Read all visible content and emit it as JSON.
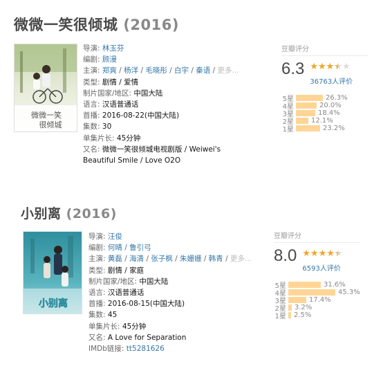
{
  "shows": [
    {
      "title": "微微一笑很倾城",
      "year": "(2016)",
      "director_label": "导演:",
      "director": "林玉芬",
      "writer_label": "编剧:",
      "writer": "顾漫",
      "cast_label": "主演:",
      "cast": [
        "郑爽",
        "杨洋",
        "毛晓彤",
        "白宇",
        "秦语"
      ],
      "cast_more": "更多...",
      "genre_label": "类型:",
      "genre": "剧情 / 爱情",
      "country_label": "制片国家/地区:",
      "country": "中国大陆",
      "language_label": "语言:",
      "language": "汉语普通话",
      "premiere_label": "首播:",
      "premiere": "2016-08-22(中国大陆)",
      "episodes_label": "集数:",
      "episodes": "30",
      "length_label": "单集片长:",
      "length": "45分钟",
      "aka_label": "又名:",
      "aka": "微微一笑很倾城电视剧版 / Weiwei's Beautiful Smile / Love O2O",
      "rating_label": "豆瓣评分",
      "score": "6.3",
      "star_fraction": 0.63,
      "votes": "36763人评价",
      "breakdown": [
        {
          "label": "5星",
          "pct_text": "26.3%",
          "pct": 26.3
        },
        {
          "label": "4星",
          "pct_text": "20.0%",
          "pct": 20.0
        },
        {
          "label": "3星",
          "pct_text": "18.4%",
          "pct": 18.4
        },
        {
          "label": "2星",
          "pct_text": "12.1%",
          "pct": 12.1
        },
        {
          "label": "1星",
          "pct_text": "23.2%",
          "pct": 23.2
        }
      ]
    },
    {
      "title": "小别离",
      "year": "(2016)",
      "director_label": "导演:",
      "director": "汪俊",
      "writer_label": "编剧:",
      "writer": "何晴 / 鲁引弓",
      "cast_label": "主演:",
      "cast": [
        "黄磊",
        "海清",
        "张子枫",
        "朱姗姗",
        "韩青"
      ],
      "cast_more": "更多...",
      "genre_label": "类型:",
      "genre": "剧情 / 家庭",
      "country_label": "制片国家/地区:",
      "country": "中国大陆",
      "language_label": "语言:",
      "language": "汉语普通话",
      "premiere_label": "首播:",
      "premiere": "2016-08-15(中国大陆)",
      "episodes_label": "集数:",
      "episodes": "45",
      "length_label": "单集片长:",
      "length": "45分钟",
      "aka_label": "又名:",
      "aka": "A Love for Separation",
      "imdb_label": "IMDb链接:",
      "imdb": "tt5281626",
      "rating_label": "豆瓣评分",
      "score": "8.0",
      "star_fraction": 0.8,
      "votes": "6593人评价",
      "breakdown": [
        {
          "label": "5星",
          "pct_text": "31.6%",
          "pct": 31.6
        },
        {
          "label": "4星",
          "pct_text": "45.3%",
          "pct": 45.3
        },
        {
          "label": "3星",
          "pct_text": "17.4%",
          "pct": 17.4
        },
        {
          "label": "2星",
          "pct_text": "3.2%",
          "pct": 3.2
        },
        {
          "label": "1星",
          "pct_text": "2.5%",
          "pct": 2.5
        }
      ]
    }
  ]
}
